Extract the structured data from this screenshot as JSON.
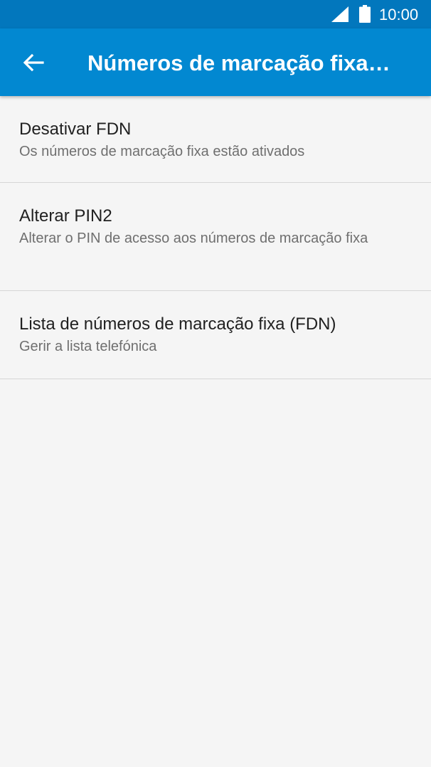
{
  "status_bar": {
    "time": "10:00",
    "icons": [
      "signal-icon",
      "battery-icon"
    ]
  },
  "app_bar": {
    "back_icon": "arrow-back-icon",
    "title": "Números de marcação fixa…"
  },
  "settings_list": [
    {
      "title": "Desativar FDN",
      "summary": "Os números de marcação fixa estão ativados"
    },
    {
      "title": "Alterar PIN2",
      "summary": "Alterar o PIN de acesso aos números de marcação fixa"
    },
    {
      "title": "Lista de números de marcação fixa (FDN)",
      "summary": "Gerir a lista telefónica"
    }
  ],
  "colors": {
    "status_bar": "#0277bd",
    "app_bar": "#0288d1",
    "background": "#f5f5f5",
    "divider": "#d6d6d6"
  }
}
